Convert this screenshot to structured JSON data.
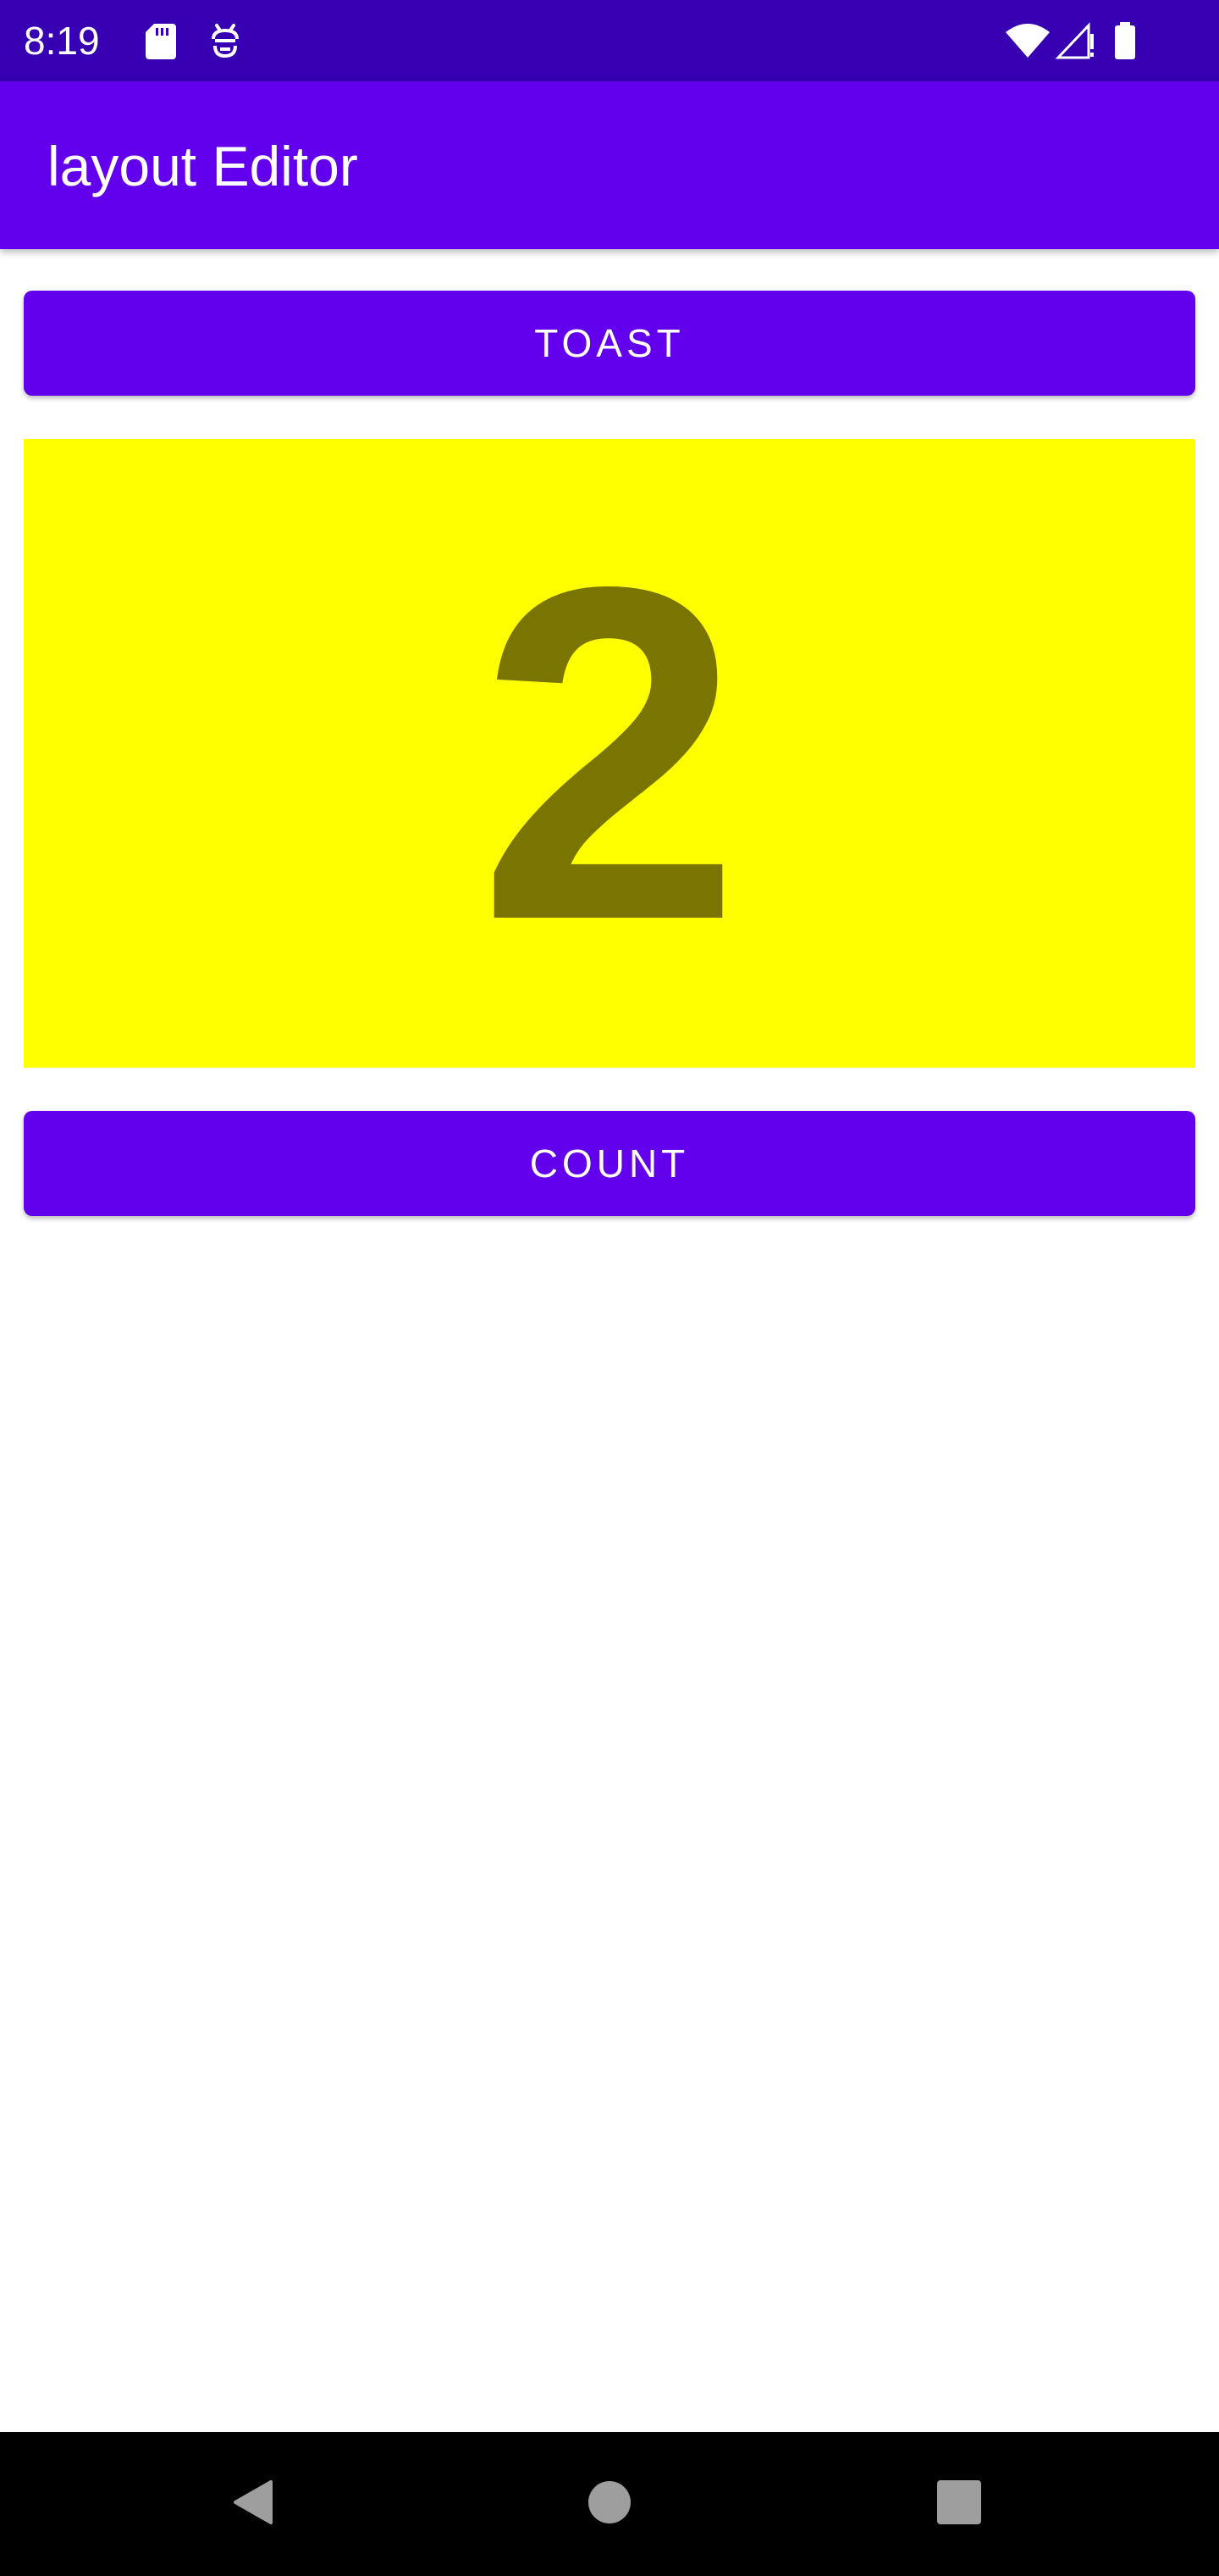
{
  "status_bar": {
    "time": "8:19",
    "icons": [
      "sd-card-icon",
      "debug-icon",
      "wifi-icon",
      "cell-signal-icon",
      "battery-icon"
    ],
    "color": "#3700b3"
  },
  "app_bar": {
    "title": "layout Editor",
    "color": "#6200ee"
  },
  "toast_button": {
    "label": "TOAST"
  },
  "count_display": {
    "value": "2",
    "background": "#ffff00",
    "text_color": "#7a7500"
  },
  "count_button": {
    "label": "COUNT"
  },
  "nav_bar": {
    "buttons": [
      "back-icon",
      "home-icon",
      "recents-icon"
    ]
  }
}
